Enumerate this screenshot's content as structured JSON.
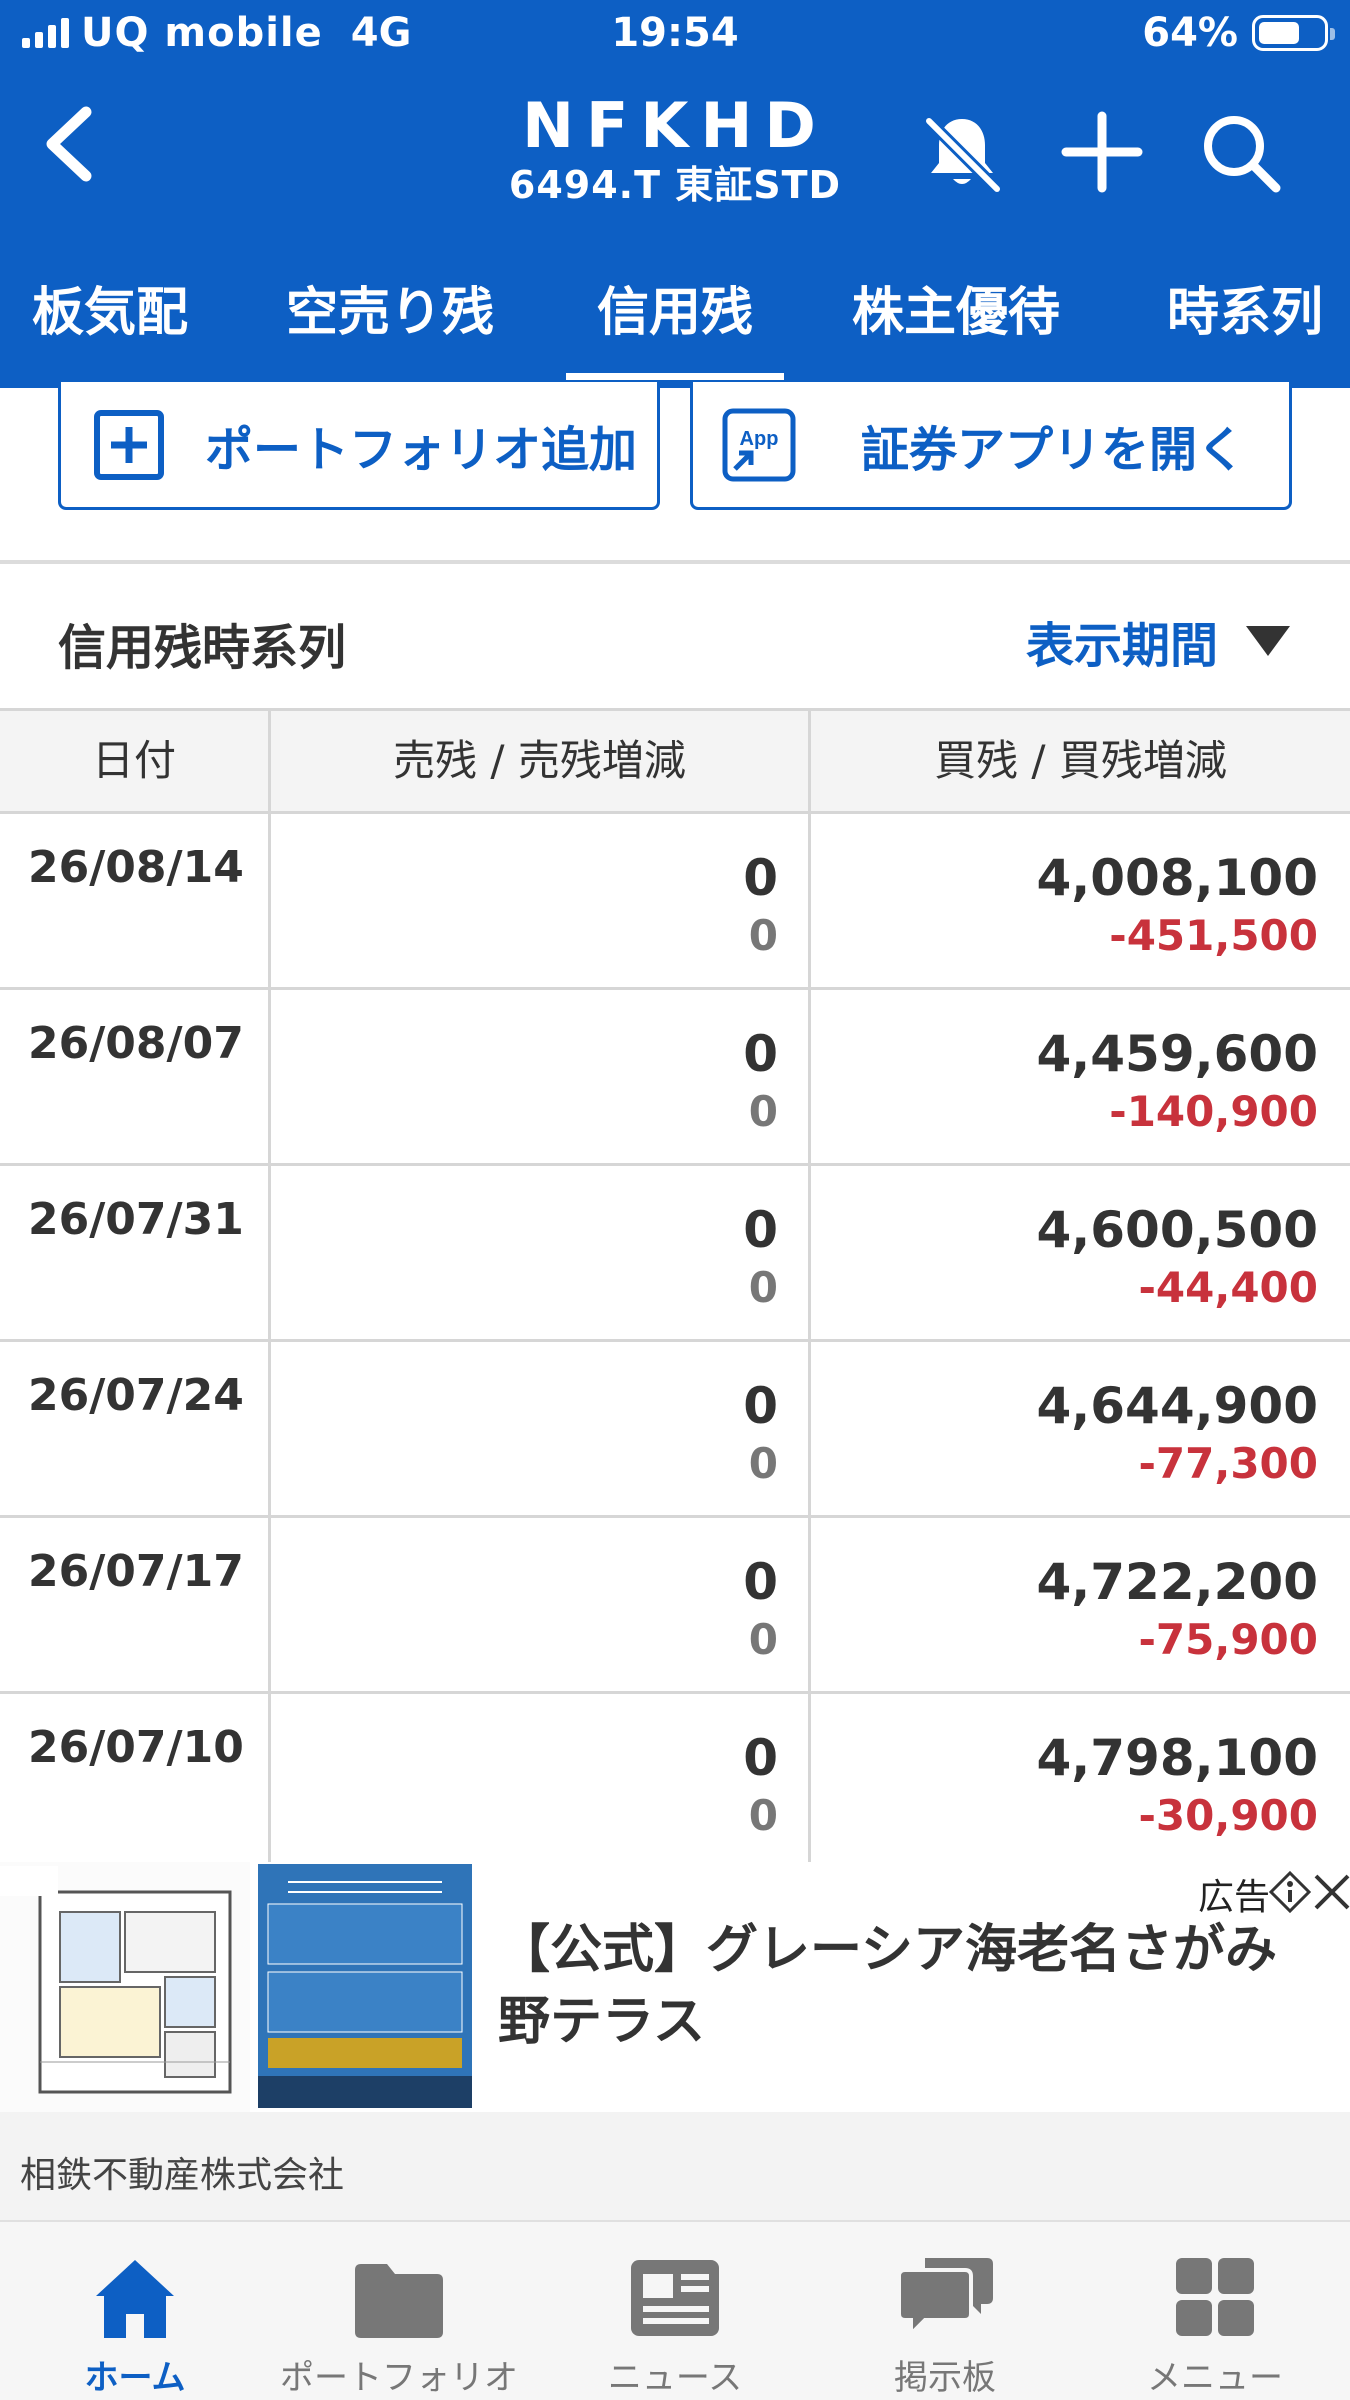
{
  "status_bar": {
    "carrier": "UQ mobile",
    "network": "4G",
    "time": "19:54",
    "battery": "64%"
  },
  "header": {
    "title": "NFKHD",
    "subtitle": "6494.T 東証STD",
    "icons": [
      "back-chevron-icon",
      "bell-off-icon",
      "plus-icon",
      "search-icon"
    ]
  },
  "tabs": [
    {
      "label": "板気配"
    },
    {
      "label": "空売り残"
    },
    {
      "label": "信用残",
      "active": true
    },
    {
      "label": "株主優待"
    },
    {
      "label": "時系列"
    }
  ],
  "actions": {
    "portfolio_add": "ポートフォリオ追加",
    "open_app": "証券アプリを開く",
    "app_icon_text": "App"
  },
  "section": {
    "title": "信用残時系列",
    "period_button": "表示期間"
  },
  "table": {
    "headers": {
      "date": "日付",
      "sell": "売残 / 売残増減",
      "buy": "買残 / 買残増減"
    },
    "rows": [
      {
        "date": "26/08/14",
        "sell": "0",
        "sell_change": "0",
        "buy": "4,008,100",
        "buy_change": "-451,500"
      },
      {
        "date": "26/08/07",
        "sell": "0",
        "sell_change": "0",
        "buy": "4,459,600",
        "buy_change": "-140,900"
      },
      {
        "date": "26/07/31",
        "sell": "0",
        "sell_change": "0",
        "buy": "4,600,500",
        "buy_change": "-44,400"
      },
      {
        "date": "26/07/24",
        "sell": "0",
        "sell_change": "0",
        "buy": "4,644,900",
        "buy_change": "-77,300"
      },
      {
        "date": "26/07/17",
        "sell": "0",
        "sell_change": "0",
        "buy": "4,722,200",
        "buy_change": "-75,900"
      },
      {
        "date": "26/07/10",
        "sell": "0",
        "sell_change": "0",
        "buy": "4,798,100",
        "buy_change": "-30,900"
      }
    ]
  },
  "ad": {
    "label": "広告",
    "title": "【公式】グレーシア海老名さがみ野テラス",
    "advertiser": "相鉄不動産株式会社"
  },
  "bottom_nav": [
    {
      "label": "ホーム",
      "icon": "home-icon",
      "active": true
    },
    {
      "label": "ポートフォリオ",
      "icon": "folder-icon"
    },
    {
      "label": "ニュース",
      "icon": "news-icon"
    },
    {
      "label": "掲示板",
      "icon": "chat-icon"
    },
    {
      "label": "メニュー",
      "icon": "menu-grid-icon"
    }
  ],
  "colors": {
    "brand_blue": "#0d5fc4",
    "negative_red": "#c8323c"
  }
}
